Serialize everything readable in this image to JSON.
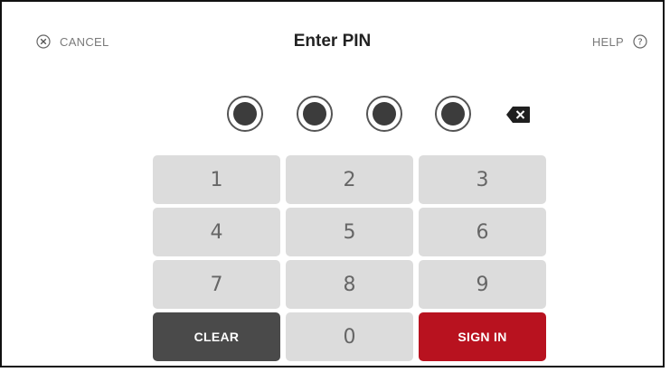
{
  "header": {
    "cancel_label": "CANCEL",
    "cancel_icon": "close-circle-icon",
    "title": "Enter PIN",
    "help_label": "HELP",
    "help_icon": "question-circle-icon"
  },
  "pin": {
    "length": 4,
    "filled": 4,
    "backspace_icon": "backspace-icon"
  },
  "keypad": {
    "keys": [
      "1",
      "2",
      "3",
      "4",
      "5",
      "6",
      "7",
      "8",
      "9"
    ],
    "zero": "0",
    "clear_label": "CLEAR",
    "signin_label": "SIGN IN"
  },
  "colors": {
    "key_bg": "#dcdcdc",
    "clear_bg": "#4a4a4a",
    "signin_bg": "#b8121f",
    "pin_dot": "#3c3c3c"
  }
}
